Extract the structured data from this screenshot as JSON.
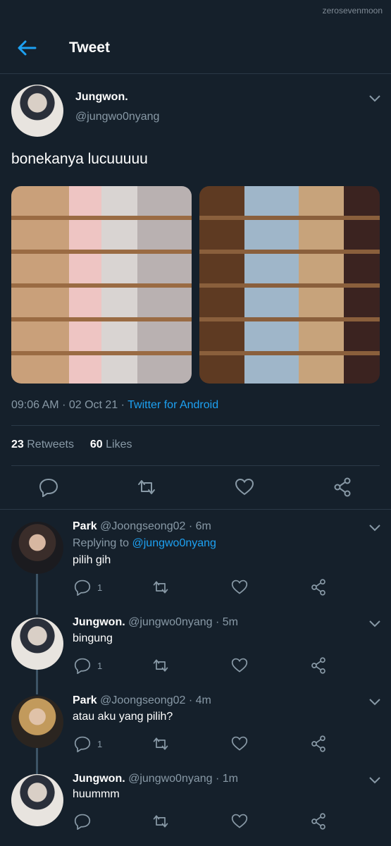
{
  "watermark": "zerosevenmoon",
  "header": {
    "title": "Tweet"
  },
  "tweet": {
    "author_name": "Jungwon.",
    "author_handle": "@jungwo0nyang",
    "text": "bonekanya lucuuuuu",
    "time": "09:06 AM",
    "date": "02 Oct 21",
    "source": "Twitter for Android",
    "retweets": "23",
    "retweets_label": "Retweets",
    "likes": "60",
    "likes_label": "Likes"
  },
  "replies": [
    {
      "name": "Park",
      "handle": "@Joongseong02",
      "time": "6m",
      "replying_label": "Replying to",
      "replying_to": "@jungwo0nyang",
      "text": "pilih gih",
      "reply_count": "1"
    },
    {
      "name": "Jungwon.",
      "handle": "@jungwo0nyang",
      "time": "5m",
      "text": "bingung",
      "reply_count": "1"
    },
    {
      "name": "Park",
      "handle": "@Joongseong02",
      "time": "4m",
      "text": "atau aku yang pilih?",
      "reply_count": "1"
    },
    {
      "name": "Jungwon.",
      "handle": "@jungwo0nyang",
      "time": "1m",
      "text": "huummm",
      "reply_count": ""
    }
  ],
  "icons": [
    "back-arrow-icon",
    "chevron-down-icon",
    "reply-icon",
    "retweet-icon",
    "like-icon",
    "share-icon"
  ],
  "colors": {
    "background": "#15202b",
    "accent": "#1da1f2",
    "muted": "#8899a6",
    "divider": "#2b3947"
  }
}
